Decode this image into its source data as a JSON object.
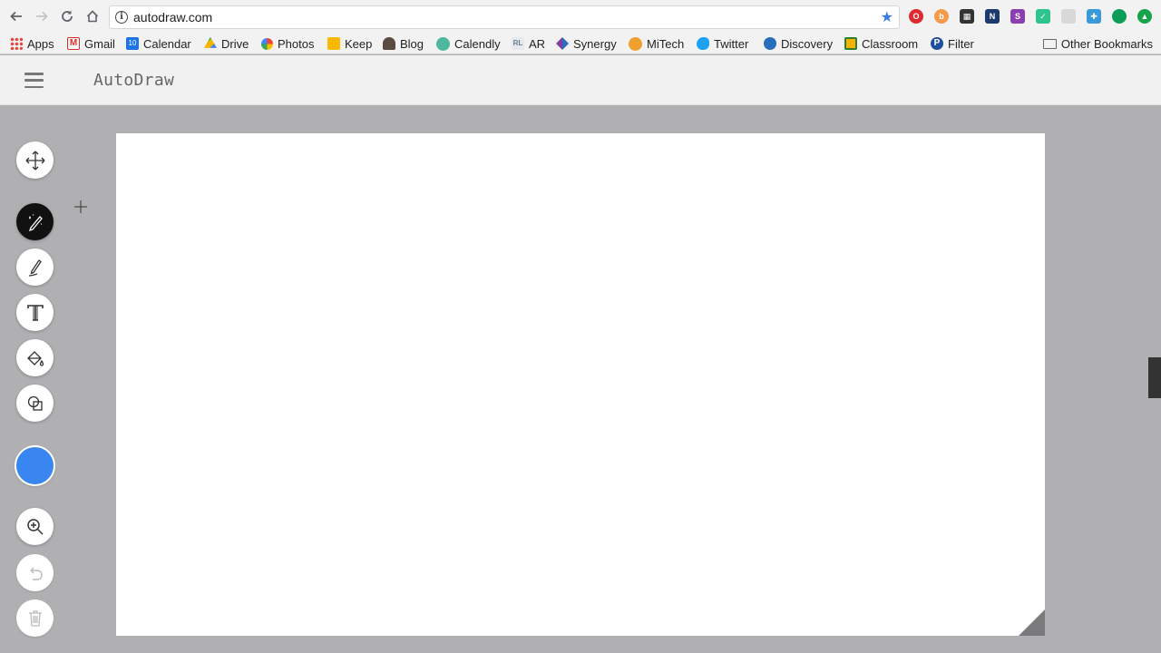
{
  "browser": {
    "url": "autodraw.com",
    "bookmarks": [
      {
        "label": "Apps",
        "color": "#e8453c"
      },
      {
        "label": "Gmail",
        "color": "#d93025"
      },
      {
        "label": "Calendar",
        "color": "#1a73e8"
      },
      {
        "label": "Drive",
        "color": "#0f9d58"
      },
      {
        "label": "Photos",
        "color": "#f4b400"
      },
      {
        "label": "Keep",
        "color": "#f9ba00"
      },
      {
        "label": "Blog",
        "color": "#5a4a42"
      },
      {
        "label": "Calendly",
        "color": "#4fb99f"
      },
      {
        "label": "AR",
        "color": "#6b7b8c"
      },
      {
        "label": "Synergy",
        "color": "#7a3fa0"
      },
      {
        "label": "MiTech",
        "color": "#f0a030"
      },
      {
        "label": "Twitter",
        "color": "#1da1f2"
      },
      {
        "label": "Discovery",
        "color": "#2a6ebb"
      },
      {
        "label": "Classroom",
        "color": "#f4b400"
      },
      {
        "label": "Filter",
        "color": "#1e4f9c"
      }
    ],
    "other_bookmarks": "Other Bookmarks",
    "calendar_badge": "10"
  },
  "app": {
    "title": "AutoDraw"
  },
  "tools": {
    "select": "select-tool",
    "autodraw": "autodraw-tool",
    "draw": "draw-tool",
    "type": "type-tool",
    "fill": "fill-tool",
    "shape": "shape-tool",
    "color": "#3a86f0",
    "zoom": "zoom-tool",
    "undo": "undo-tool",
    "delete": "delete-tool"
  }
}
